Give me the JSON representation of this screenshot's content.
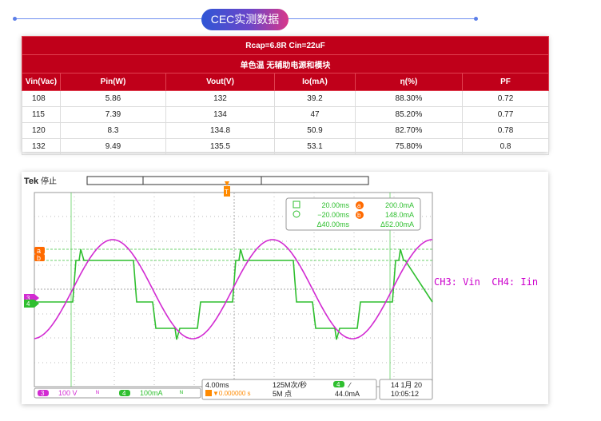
{
  "section_title": "CEC实测数据",
  "table": {
    "header1": "Rcap=6.8R Cin=22uF",
    "header2": "单色温 无辅助电源和模块",
    "columns": [
      "Vin(Vac)",
      "Pin(W)",
      "Vout(V)",
      "Io(mA)",
      "η(%)",
      "PF"
    ],
    "rows": [
      [
        "108",
        "5.86",
        "132",
        "39.2",
        "88.30%",
        "0.72"
      ],
      [
        "115",
        "7.39",
        "134",
        "47",
        "85.20%",
        "0.77"
      ],
      [
        "120",
        "8.3",
        "134.8",
        "50.9",
        "82.70%",
        "0.78"
      ],
      [
        "132",
        "9.49",
        "135.5",
        "53.1",
        "75.80%",
        "0.8"
      ]
    ]
  },
  "scope": {
    "brand": "Tek",
    "state": "停止",
    "trigger_marker": "T",
    "cursor_a_marker": "a",
    "cursor_b_marker": "b",
    "ch3_marker": "3",
    "ch4_marker": "4",
    "cursor_box": {
      "t1": "20.00ms",
      "t2": "−20.00ms",
      "dt": "Δ40.00ms",
      "a_val": "200.0mA",
      "b_val": "148.0mA",
      "dv": "Δ52.00mA"
    },
    "bottom": {
      "ch3_num": "3",
      "ch3_scale": "100 V",
      "ch3_bw": "ᴺ",
      "ch4_num": "4",
      "ch4_scale": "100mA",
      "ch4_bw": "ᴺ",
      "timebase": "4.00ms",
      "trigger_pos": "▼0.000000 s",
      "sample_rate": "125M次/秒",
      "record_length": "5M 点",
      "trig_ch": "4",
      "trig_slope": "∕",
      "trig_level": "44.0mA",
      "date": "14 1月 20",
      "time": "10:05:12"
    },
    "colors": {
      "ch3": "#d22bd2",
      "ch4": "#2fbf2f",
      "cursor": "#ff6a00"
    }
  },
  "legend": "CH3: Vin  CH4: Iin"
}
